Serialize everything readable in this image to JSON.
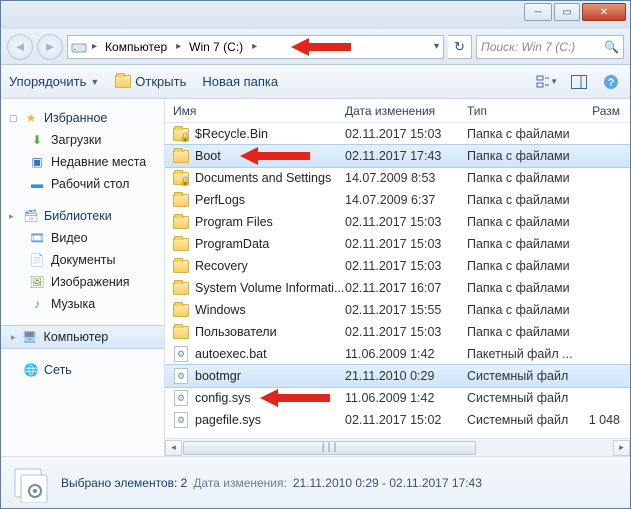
{
  "breadcrumbs": {
    "root": "Компьютер",
    "drive": "Win 7 (C:)"
  },
  "search": {
    "placeholder": "Поиск: Win 7 (C:)"
  },
  "toolbar": {
    "organize": "Упорядочить",
    "open": "Открыть",
    "newfolder": "Новая папка"
  },
  "sidebar": {
    "fav_head": "Избранное",
    "fav": [
      "Загрузки",
      "Недавние места",
      "Рабочий стол"
    ],
    "lib_head": "Библиотеки",
    "lib": [
      "Видео",
      "Документы",
      "Изображения",
      "Музыка"
    ],
    "computer": "Компьютер",
    "network": "Сеть"
  },
  "columns": {
    "name": "Имя",
    "date": "Дата изменения",
    "type": "Тип",
    "size": "Разм"
  },
  "type_labels": {
    "folder": "Папка с файлами",
    "batch": "Пакетный файл ...",
    "sysfile": "Системный файл"
  },
  "rows": [
    {
      "kind": "folder",
      "lock": true,
      "name": "$Recycle.Bin",
      "date": "02.11.2017 15:03",
      "typek": "folder",
      "size": ""
    },
    {
      "kind": "folder",
      "lock": false,
      "name": "Boot",
      "date": "02.11.2017 17:43",
      "typek": "folder",
      "size": "",
      "sel": true,
      "arrow": true
    },
    {
      "kind": "folder",
      "lock": true,
      "name": "Documents and Settings",
      "date": "14.07.2009 8:53",
      "typek": "folder",
      "size": ""
    },
    {
      "kind": "folder",
      "lock": false,
      "name": "PerfLogs",
      "date": "14.07.2009 6:37",
      "typek": "folder",
      "size": ""
    },
    {
      "kind": "folder",
      "lock": false,
      "name": "Program Files",
      "date": "02.11.2017 15:03",
      "typek": "folder",
      "size": ""
    },
    {
      "kind": "folder",
      "lock": false,
      "name": "ProgramData",
      "date": "02.11.2017 15:03",
      "typek": "folder",
      "size": ""
    },
    {
      "kind": "folder",
      "lock": false,
      "name": "Recovery",
      "date": "02.11.2017 15:03",
      "typek": "folder",
      "size": ""
    },
    {
      "kind": "folder",
      "lock": false,
      "name": "System Volume Informati...",
      "date": "02.11.2017 16:07",
      "typek": "folder",
      "size": ""
    },
    {
      "kind": "folder",
      "lock": false,
      "name": "Windows",
      "date": "02.11.2017 15:55",
      "typek": "folder",
      "size": ""
    },
    {
      "kind": "folder",
      "lock": false,
      "name": "Пользователи",
      "date": "02.11.2017 15:03",
      "typek": "folder",
      "size": ""
    },
    {
      "kind": "file",
      "name": "autoexec.bat",
      "date": "11.06.2009 1:42",
      "typek": "batch",
      "size": ""
    },
    {
      "kind": "file",
      "name": "bootmgr",
      "date": "21.11.2010 0:29",
      "typek": "sysfile",
      "size": "",
      "sel": true,
      "arrow": true
    },
    {
      "kind": "file",
      "name": "config.sys",
      "date": "11.06.2009 1:42",
      "typek": "sysfile",
      "size": ""
    },
    {
      "kind": "file",
      "name": "pagefile.sys",
      "date": "02.11.2017 15:02",
      "typek": "sysfile",
      "size": "1 048"
    }
  ],
  "details": {
    "selected": "Выбрано элементов: 2",
    "date_label": "Дата изменения:",
    "date_value": "21.11.2010 0:29 - 02.11.2017 17:43"
  }
}
